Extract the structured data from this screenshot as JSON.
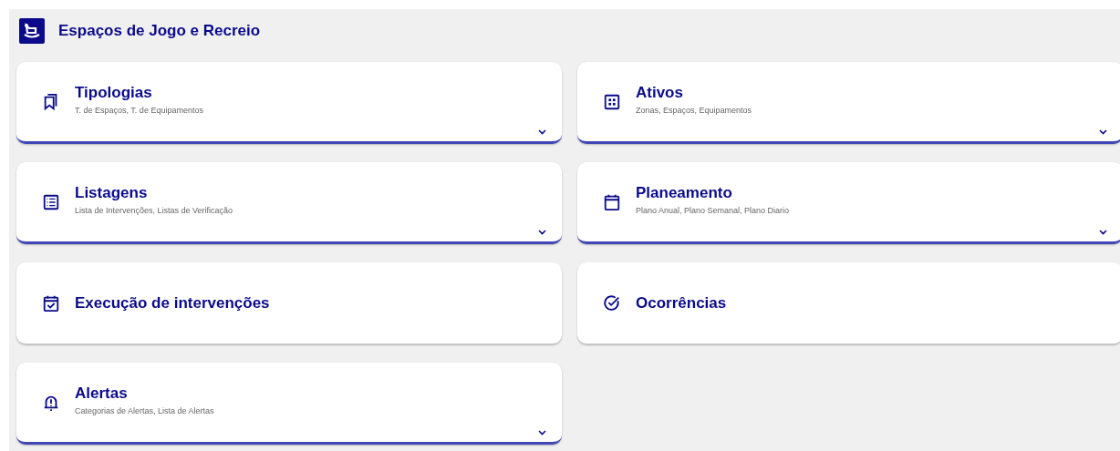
{
  "header": {
    "title": "Espaços de Jogo e Recreio"
  },
  "cards": [
    {
      "kind": "expandable",
      "title": "Tipologias",
      "subtitle": "T. de Espaços, T. de Equipamentos",
      "expanded": false
    },
    {
      "kind": "expandable",
      "title": "Ativos",
      "subtitle": "Zonas, Espaços, Equipamentos",
      "expanded": false
    },
    {
      "kind": "expandable",
      "title": "Listagens",
      "subtitle": "Lista de Intervenções, Listas de Verificação",
      "expanded": false
    },
    {
      "kind": "expandable",
      "title": "Planeamento",
      "subtitle": "Plano Anual, Plano Semanal, Plano Diario",
      "expanded": false
    },
    {
      "kind": "link",
      "title": "Execução de intervenções"
    },
    {
      "kind": "link",
      "title": "Ocorrências"
    },
    {
      "kind": "expandable",
      "title": "Alertas",
      "subtitle": "Categorias de Alertas, Lista de Alertas",
      "expanded": false
    }
  ]
}
